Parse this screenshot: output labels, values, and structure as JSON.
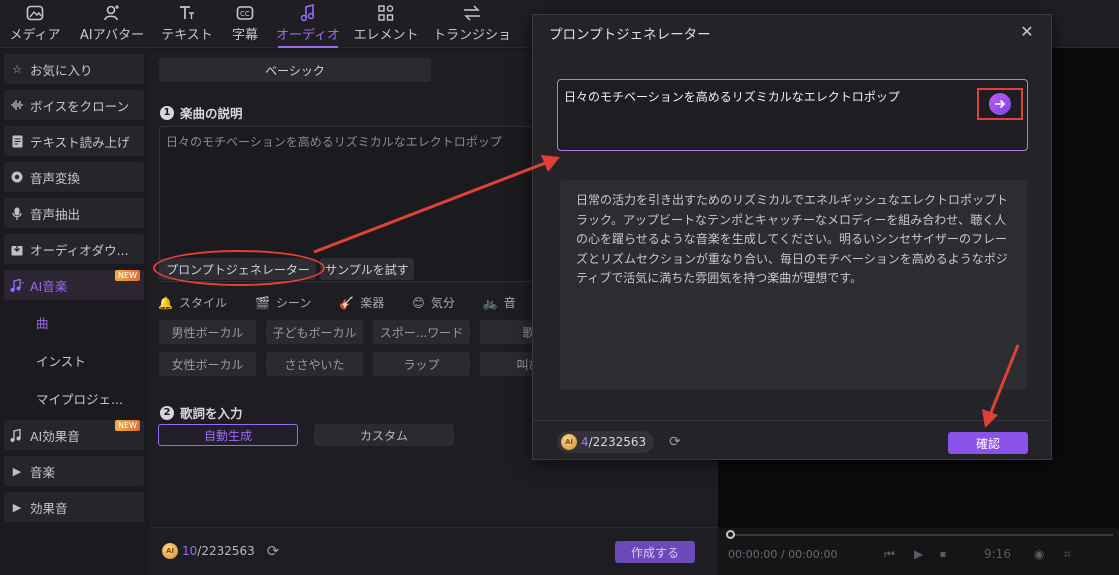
{
  "toolbar": {
    "tabs": [
      {
        "label": "メディア",
        "icon": "media-icon"
      },
      {
        "label": "AIアバター",
        "icon": "avatar-icon"
      },
      {
        "label": "テキスト",
        "icon": "text-icon"
      },
      {
        "label": "字幕",
        "icon": "caption-icon"
      },
      {
        "label": "オーディオ",
        "icon": "music-note-icon"
      },
      {
        "label": "エレメント",
        "icon": "elements-icon"
      },
      {
        "label": "トランジショ",
        "icon": "transition-icon"
      }
    ],
    "active_tab": "オーディオ"
  },
  "sidebar": {
    "items": [
      {
        "label": "お気に入り",
        "icon": "star-icon"
      },
      {
        "label": "ボイスをクローン",
        "icon": "waveform-icon"
      },
      {
        "label": "テキスト読み上げ",
        "icon": "document-icon"
      },
      {
        "label": "音声変換",
        "icon": "voice-change-icon"
      },
      {
        "label": "音声抽出",
        "icon": "microphone-icon"
      },
      {
        "label": "オーディオダウ...",
        "icon": "download-icon"
      },
      {
        "label": "AI音楽",
        "icon": "ai-music-icon",
        "badge": "NEW"
      }
    ],
    "sub_items": [
      "曲",
      "インスト",
      "マイプロジェ..."
    ],
    "items_after": [
      {
        "label": "AI効果音",
        "icon": "ai-sfx-icon",
        "badge": "NEW"
      },
      {
        "label": "音楽",
        "icon": "caret-right-icon"
      },
      {
        "label": "効果音",
        "icon": "caret-right-icon"
      }
    ]
  },
  "main": {
    "basic_label": "ベーシック",
    "section1": {
      "number": "1",
      "title": "楽曲の説明"
    },
    "description_text": "日々のモチベーションを高めるリズミカルなエレクトロポップ",
    "prompt_generator_label": "プロンプトジェネレーター",
    "sample_label": "サンプルを試す",
    "categories": [
      "スタイル",
      "シーン",
      "楽器",
      "気分",
      "音"
    ],
    "tags_row1": [
      "男性ボーカル",
      "子どもボーカル",
      "スポー...ワード",
      "歌"
    ],
    "tags_row2": [
      "女性ボーカル",
      "ささやいた",
      "ラップ",
      "叫び"
    ],
    "section2": {
      "number": "2",
      "title": "歌詞を入力"
    },
    "mode_auto": "自動生成",
    "mode_custom": "カスタム",
    "credit_used": "10",
    "credit_total": "/2232563",
    "create_label": "作成する"
  },
  "player": {
    "time": "00:00:00 / 00:00:00",
    "ratio": "9:16"
  },
  "modal": {
    "title": "プロンプトジェネレーター",
    "prompt_value": "日々のモチベーションを高めるリズミカルなエレクトロポップ",
    "generated_text": "日常の活力を引き出すためのリズミカルでエネルギッシュなエレクトロポップトラック。アップビートなテンポとキャッチーなメロディーを組み合わせ、聴く人の心を躍らせるような音楽を生成してください。明るいシンセサイザーのフレーズとリズムセクションが重なり合い、毎日のモチベーションを高めるようなポジティブで活気に満ちた雰囲気を持つ楽曲が理想です。",
    "credit_used": "4",
    "credit_total": "/2232563",
    "confirm_label": "確認"
  },
  "colors": {
    "accent": "#9a6cf2",
    "annotation_red": "#e0403a"
  }
}
